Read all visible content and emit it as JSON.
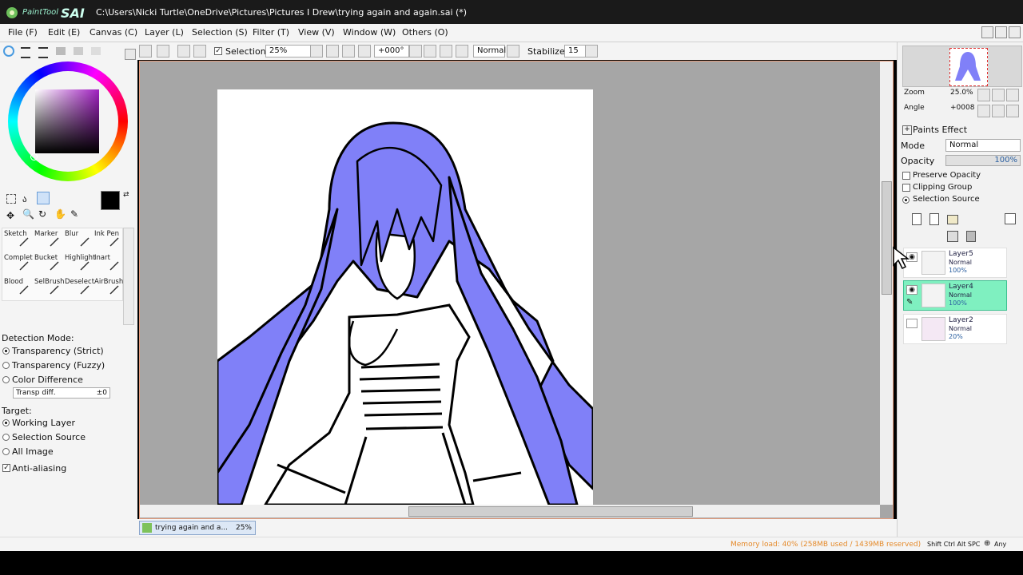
{
  "window": {
    "title": "C:\\Users\\Nicki Turtle\\OneDrive\\Pictures\\Pictures I Drew\\trying again and again.sai (*)",
    "logo_text": "PaintTool",
    "logo_sai": "SAI"
  },
  "menu": [
    "File (F)",
    "Edit (E)",
    "Canvas (C)",
    "Layer (L)",
    "Selection (S)",
    "Filter (T)",
    "View (V)",
    "Window (W)",
    "Others (O)"
  ],
  "toolbar": {
    "selection_label": "Selection",
    "zoom": "25%",
    "angle": "+000°",
    "blend_mode": "Normal",
    "stabilizer_label": "Stabilizer",
    "stabilizer_value": "15"
  },
  "tools": {
    "row1": [
      "Sketch",
      "Marker",
      "Blur",
      "Ink Pen"
    ],
    "row2": [
      "Complet",
      "Bucket",
      "Highlight",
      "Inart"
    ],
    "row3": [
      "Blood",
      "SelBrush",
      "Deselect",
      "AirBrush"
    ]
  },
  "selection_options": {
    "detection_label": "Detection Mode:",
    "detection_modes": [
      "Transparency (Strict)",
      "Transparency (Fuzzy)",
      "Color Difference"
    ],
    "detection_selected": 0,
    "transp_diff_label": "Transp diff.",
    "transp_diff_value": "±0",
    "target_label": "Target:",
    "targets": [
      "Working Layer",
      "Selection Source",
      "All Image"
    ],
    "target_selected": 0,
    "anti_aliasing_label": "Anti-aliasing",
    "anti_aliasing": true
  },
  "navigator": {
    "zoom_label": "Zoom",
    "zoom_value": "25.0%",
    "angle_label": "Angle",
    "angle_value": "+0008"
  },
  "layer_props": {
    "paints_effect": "Paints Effect",
    "mode_label": "Mode",
    "mode_value": "Normal",
    "opacity_label": "Opacity",
    "opacity_value": "100%",
    "preserve_opacity": "Preserve Opacity",
    "clipping_group": "Clipping Group",
    "selection_source": "Selection Source"
  },
  "layers": [
    {
      "name": "Layer5",
      "mode": "Normal",
      "opacity": "100%",
      "visible": true,
      "selected": false
    },
    {
      "name": "Layer4",
      "mode": "Normal",
      "opacity": "100%",
      "visible": true,
      "selected": true
    },
    {
      "name": "Layer2",
      "mode": "Normal",
      "opacity": "20%",
      "visible": false,
      "selected": false
    }
  ],
  "document_tab": {
    "name": "trying again and a...",
    "zoom": "25%"
  },
  "status": {
    "memory": "Memory load: 40% (258MB used / 1439MB reserved)",
    "keys": "Shift Ctrl Alt SPC",
    "any": "Any"
  },
  "colors": {
    "hair": "#8080f8",
    "primary": "#000000",
    "selected_layer": "#7ff0c0"
  }
}
